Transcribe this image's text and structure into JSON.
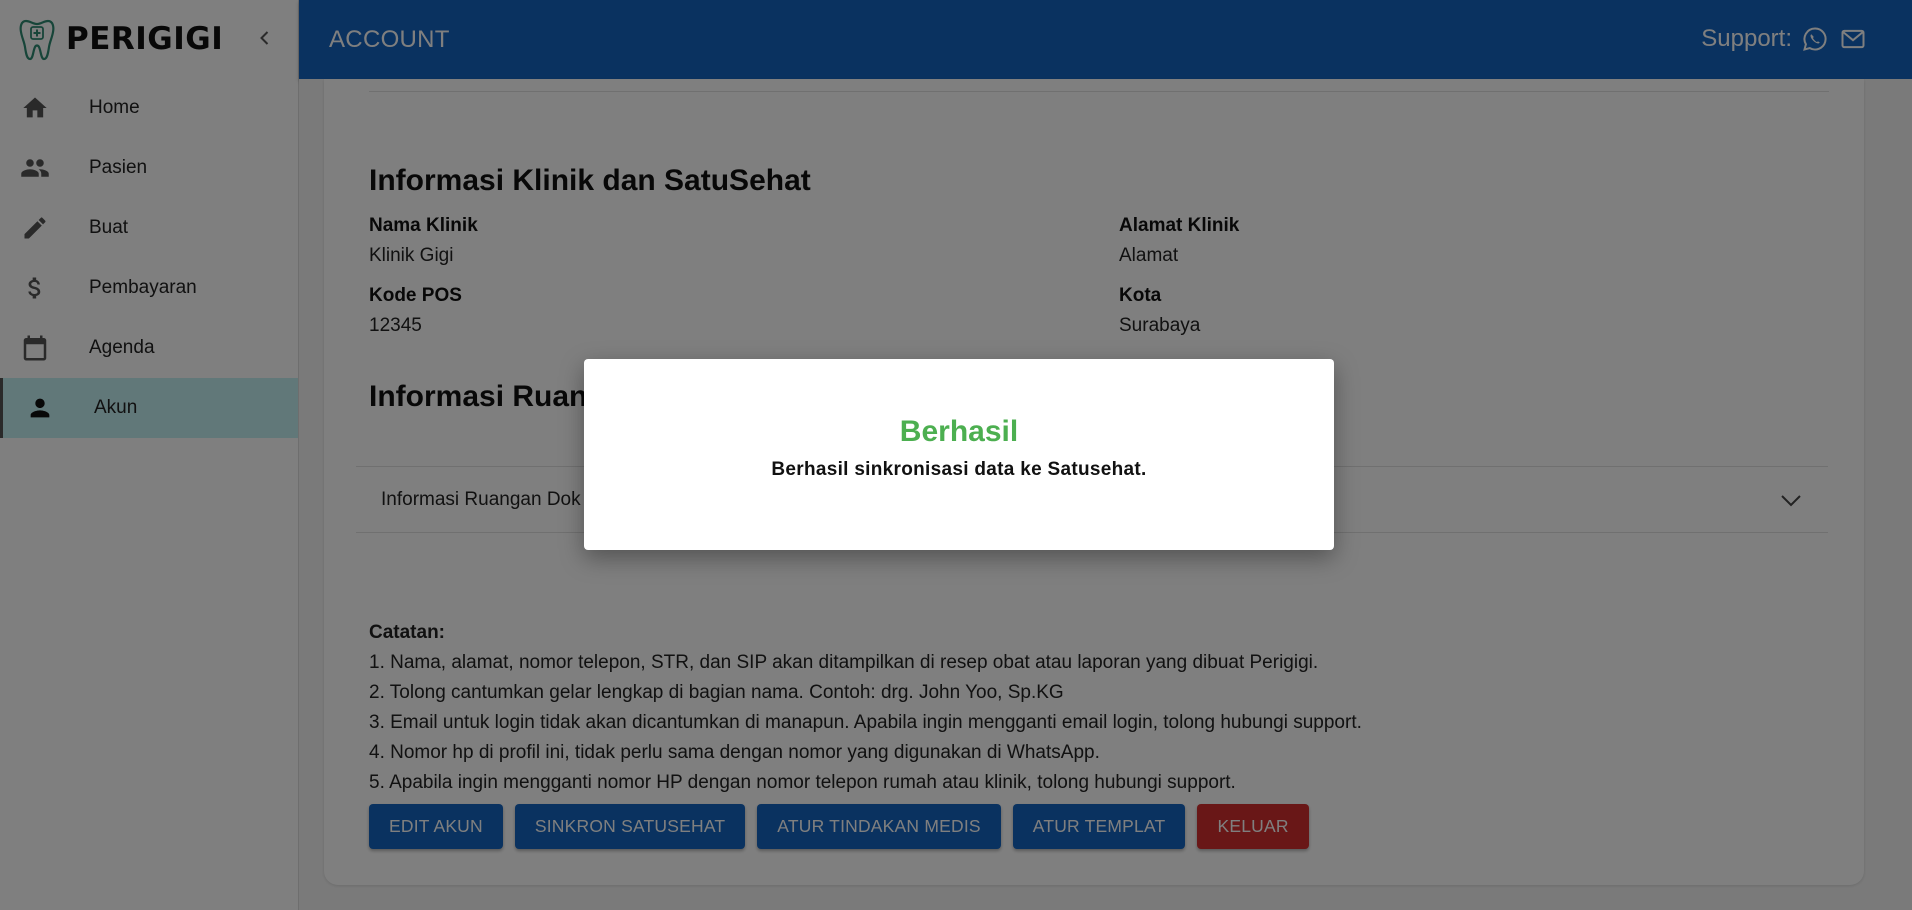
{
  "app": {
    "brand_name": "PERIGIGI"
  },
  "sidebar": {
    "items": [
      {
        "label": "Home",
        "icon": "home-icon"
      },
      {
        "label": "Pasien",
        "icon": "people-icon"
      },
      {
        "label": "Buat",
        "icon": "pencil-icon"
      },
      {
        "label": "Pembayaran",
        "icon": "dollar-icon"
      },
      {
        "label": "Agenda",
        "icon": "calendar-icon"
      },
      {
        "label": "Akun",
        "icon": "person-icon",
        "active": true
      }
    ]
  },
  "header": {
    "title": "ACCOUNT",
    "support_label": "Support:",
    "support_icons": [
      "whatsapp-icon",
      "mail-icon"
    ]
  },
  "clinic": {
    "section_title": "Informasi Klinik dan SatuSehat",
    "name_label": "Nama Klinik",
    "name_value": "Klinik Gigi",
    "address_label": "Alamat Klinik",
    "address_value": "Alamat",
    "postal_label": "Kode POS",
    "postal_value": "12345",
    "city_label": "Kota",
    "city_value": "Surabaya"
  },
  "rooms": {
    "section_title": "Informasi Ruan",
    "accordion_label": "Informasi Ruangan Dok"
  },
  "notes": {
    "title": "Catatan:",
    "lines": [
      "1. Nama, alamat, nomor telepon, STR, dan SIP akan ditampilkan di resep obat atau laporan yang dibuat Perigigi.",
      "2. Tolong cantumkan gelar lengkap di bagian nama. Contoh: drg. John Yoo, Sp.KG",
      "3. Email untuk login tidak akan dicantumkan di manapun. Apabila ingin mengganti email login, tolong hubungi support.",
      "4. Nomor hp di profil ini, tidak perlu sama dengan nomor yang digunakan di WhatsApp.",
      "5. Apabila ingin mengganti nomor HP dengan nomor telepon rumah atau klinik, tolong hubungi support."
    ]
  },
  "buttons": {
    "edit": "EDIT AKUN",
    "sync": "SINKRON SATUSEHAT",
    "actions": "ATUR TINDAKAN MEDIS",
    "template": "ATUR TEMPLAT",
    "logout": "KELUAR"
  },
  "dialog": {
    "title": "Berhasil",
    "message": "Berhasil sinkronisasi data ke Satusehat."
  },
  "colors": {
    "primary": "#1565c0",
    "danger": "#d32f2f",
    "success": "#4caf50",
    "active_nav": "#c3f0f3"
  }
}
